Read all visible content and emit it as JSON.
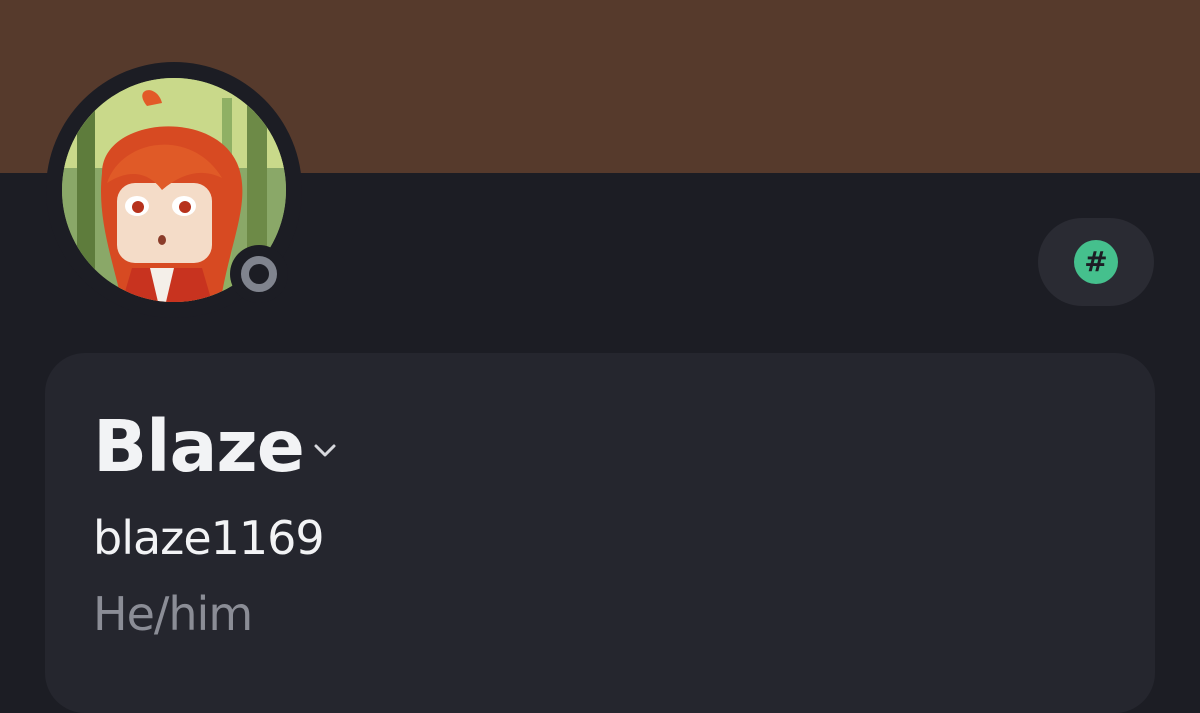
{
  "profile": {
    "display_name": "Blaze",
    "username": "blaze1169",
    "pronouns": "He/him",
    "status": "offline"
  },
  "icons": {
    "avatar": "avatar-image",
    "status": "offline-status-icon",
    "chevron": "chevron-down-icon",
    "badge": "hash-icon",
    "badge_glyph": "#"
  },
  "colors": {
    "banner": "#563a2c",
    "background": "#1c1d24",
    "card": "#25262e",
    "badge_accent": "#45c08d",
    "status_offline": "#80848e",
    "pronoun_text": "#8b8d96"
  }
}
